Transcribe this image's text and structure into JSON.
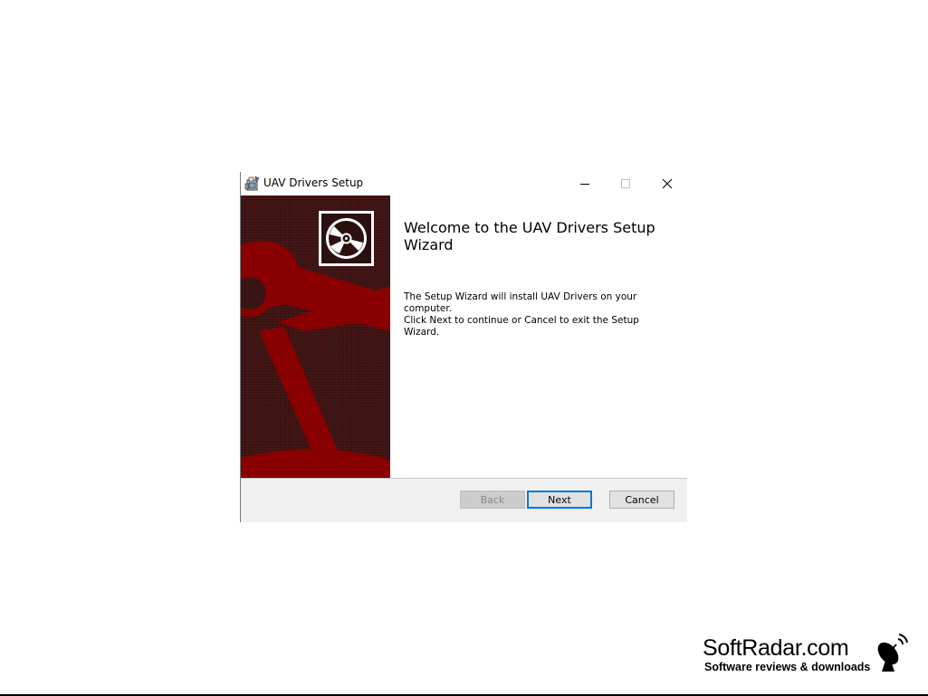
{
  "window": {
    "title": "UAV Drivers Setup",
    "controls": {
      "minimize": "—",
      "maximize": "☐",
      "close": "✕"
    }
  },
  "wizard": {
    "heading": "Welcome to the UAV Drivers Setup Wizard",
    "body_line1": "The Setup Wizard will install UAV Drivers on your computer.",
    "body_line2": "Click Next to continue or Cancel to exit the Setup Wizard."
  },
  "buttons": {
    "back": {
      "label": "Back",
      "enabled": false
    },
    "next": {
      "label": "Next",
      "enabled": true,
      "focused": true
    },
    "cancel": {
      "label": "Cancel",
      "enabled": true
    }
  },
  "watermark": {
    "name": "SoftRadar.com",
    "tagline": "Software reviews & downloads"
  },
  "colors": {
    "banner_dark": "#3a1414",
    "banner_red": "#8b0000",
    "focus_blue": "#0078d7",
    "footer_bg": "#f0f0f0"
  },
  "icons": {
    "app": "installer-icon",
    "banner_logo": "cd-disc-icon",
    "watermark_logo": "satellite-dish-icon"
  }
}
